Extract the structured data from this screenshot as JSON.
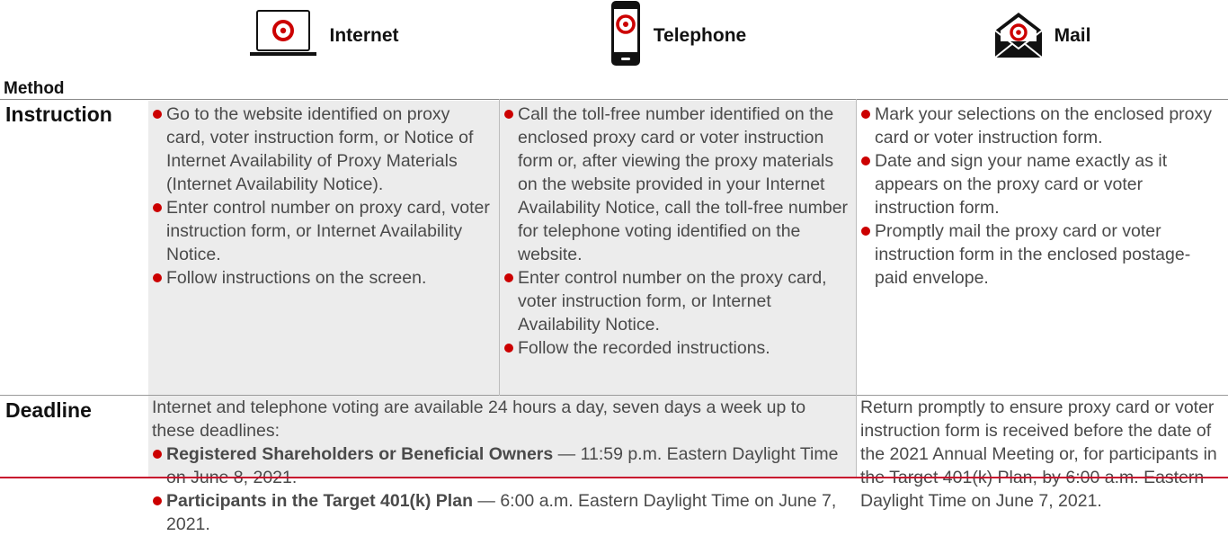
{
  "header": {
    "method_label": "Method",
    "columns": [
      {
        "label": "Internet",
        "icon": "laptop-icon"
      },
      {
        "label": "Telephone",
        "icon": "phone-icon"
      },
      {
        "label": "Mail",
        "icon": "envelope-icon"
      }
    ]
  },
  "rows": {
    "instruction": {
      "label": "Instruction",
      "internet": [
        "Go to the website identified on proxy card, voter instruction form, or Notice of Internet Availability of Proxy Materials (Internet Availability Notice).",
        "Enter control number on proxy card, voter instruction form, or Internet Availability Notice.",
        "Follow instructions on the screen."
      ],
      "telephone": [
        "Call the toll-free number identified on the enclosed proxy card or voter instruction form or, after viewing the proxy materials on the website provided in your Internet Availability Notice, call the toll-free number for telephone voting identified on the website.",
        "Enter control number on the proxy card, voter instruction form, or Internet Availability Notice.",
        "Follow the recorded instructions."
      ],
      "mail": [
        "Mark your selections on the enclosed proxy card or voter instruction form.",
        "Date and sign your name exactly as it appears on the proxy card or voter instruction form.",
        "Promptly mail the proxy card or voter instruction form in the enclosed postage-paid envelope."
      ]
    },
    "deadline": {
      "label": "Deadline",
      "internet_telephone": {
        "intro": "Internet and telephone voting are available 24 hours a day, seven days a week up to these deadlines:",
        "items": [
          {
            "bold": "Registered Shareholders or Beneficial Owners",
            "text": " — 11:59 p.m. Eastern Daylight Time on June 8, 2021."
          },
          {
            "bold": "Participants in the Target 401(k) Plan",
            "text": " — 6:00 a.m. Eastern Daylight Time on June 7, 2021."
          }
        ]
      },
      "mail": "Return promptly to ensure proxy card or voter instruction form is received before the date of the 2021 Annual Meeting or, for participants in the Target 401(k) Plan, by 6:00 a.m. Eastern Daylight Time on June 7, 2021."
    }
  },
  "colors": {
    "accent": "#cc0000",
    "cell_bg": "#ececec",
    "rule": "#c8102e"
  }
}
